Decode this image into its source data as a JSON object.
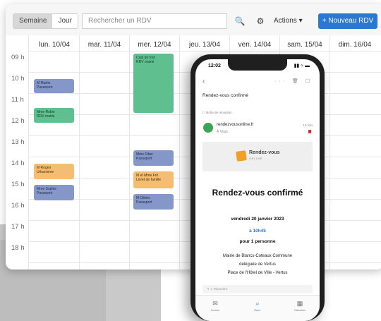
{
  "toolbar": {
    "view_week": "Semaine",
    "view_day": "Jour",
    "search_placeholder": "Rechercher un RDV",
    "search_icon": "🔍",
    "settings_icon": "⚙",
    "actions_label": "Actions ▾",
    "new_label": "+ Nouveau RDV"
  },
  "calendar": {
    "days": [
      "lun. 10/04",
      "mar. 11/04",
      "mer. 12/04",
      "jeu. 13/04",
      "ven. 14/04",
      "sam. 15/04",
      "dim. 16/04"
    ],
    "hours": [
      "09 h",
      "10 h",
      "11 h",
      "12 h",
      "13 h",
      "14 h",
      "15 h",
      "16 h",
      "17 h",
      "18 h"
    ],
    "events": [
      {
        "title": "M Martin",
        "sub": "Passeport",
        "color": "blue"
      },
      {
        "title": "Mme Robin",
        "sub": "RDV mairie",
        "color": "green"
      },
      {
        "title": "M Rogen",
        "sub": "Urbanisme",
        "color": "orange"
      },
      {
        "title": "Mme Sophie",
        "sub": "Passeport",
        "color": "blue"
      },
      {
        "title": "Club de foot",
        "sub": "RDV mairie",
        "color": "green"
      },
      {
        "title": "Mme Fiber",
        "sub": "Passeport",
        "color": "blue"
      },
      {
        "title": "M et Mme Frit",
        "sub": "Livret de famille",
        "color": "orange"
      },
      {
        "title": "M Olivier",
        "sub": "Passeport",
        "color": "blue"
      }
    ]
  },
  "phone": {
    "time": "12:02",
    "status_icons": "▮▮ ≈ ▬",
    "mail_icons": "··· 🗑 ☐",
    "subject": "Rendez-vous confirmé",
    "folder": "☐ Boîte de réception",
    "sender": "rendezvousonline.fr",
    "to": "À Vous",
    "sent_time": "10 min",
    "logo_text": "Rendez-vous",
    "logo_sub": "ONLINE",
    "title": "Rendez-vous confirmé",
    "date": "vendredi 20 janvier 2023",
    "hour": "à 10h45",
    "people": "pour 1 personne",
    "address": [
      "Mairie de Blancs-Coteaux Commune",
      "déléguée de Vertus",
      "Place de l'Hôtel de Ville - Vertus"
    ],
    "reply": "↰ ∨  Répondre",
    "nav": [
      {
        "icon": "✉",
        "label": "Courrier"
      },
      {
        "icon": "⌕",
        "label": "Rech."
      },
      {
        "icon": "▦",
        "label": "Calendrier"
      }
    ]
  }
}
